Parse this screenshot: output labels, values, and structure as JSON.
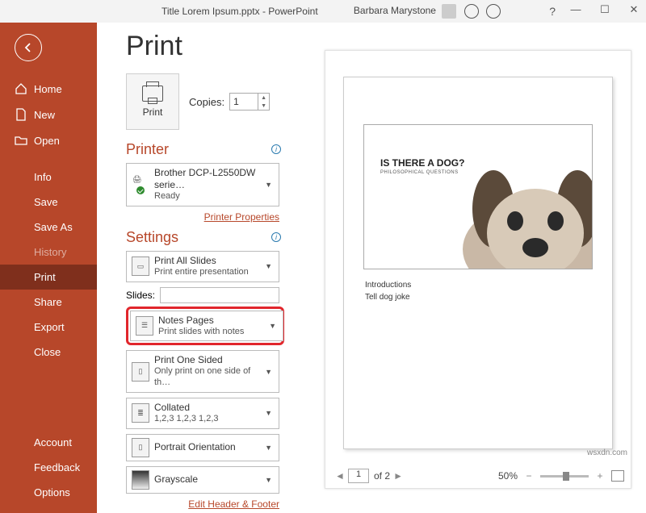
{
  "titlebar": {
    "filename": "Title Lorem Ipsum.pptx",
    "app": "PowerPoint",
    "user": "Barbara Marystone",
    "help": "?"
  },
  "sidebar": {
    "home": "Home",
    "new": "New",
    "open": "Open",
    "info": "Info",
    "save": "Save",
    "saveas": "Save As",
    "history": "History",
    "print": "Print",
    "share": "Share",
    "export": "Export",
    "close": "Close",
    "account": "Account",
    "feedback": "Feedback",
    "options": "Options"
  },
  "print": {
    "heading": "Print",
    "print_btn": "Print",
    "copies_label": "Copies:",
    "copies_value": "1",
    "printer_heading": "Printer",
    "printer_name": "Brother DCP-L2550DW serie…",
    "printer_status": "Ready",
    "printer_props": "Printer Properties",
    "settings_heading": "Settings",
    "all_slides_t": "Print All Slides",
    "all_slides_s": "Print entire presentation",
    "slides_label": "Slides:",
    "notes_t": "Notes Pages",
    "notes_s": "Print slides with notes",
    "onesided_t": "Print One Sided",
    "onesided_s": "Only print on one side of th…",
    "collated_t": "Collated",
    "collated_s": "1,2,3    1,2,3    1,2,3",
    "portrait_t": "Portrait Orientation",
    "grayscale_t": "Grayscale",
    "edit_hf": "Edit Header & Footer"
  },
  "preview": {
    "slide_title": "IS THERE A DOG?",
    "slide_sub": "PHILOSOPHICAL QUESTIONS",
    "note1": "Introductions",
    "note2": "Tell  dog joke",
    "page": "1",
    "of": "of 2",
    "zoom": "50%",
    "watermark": "wsxdn.com"
  }
}
